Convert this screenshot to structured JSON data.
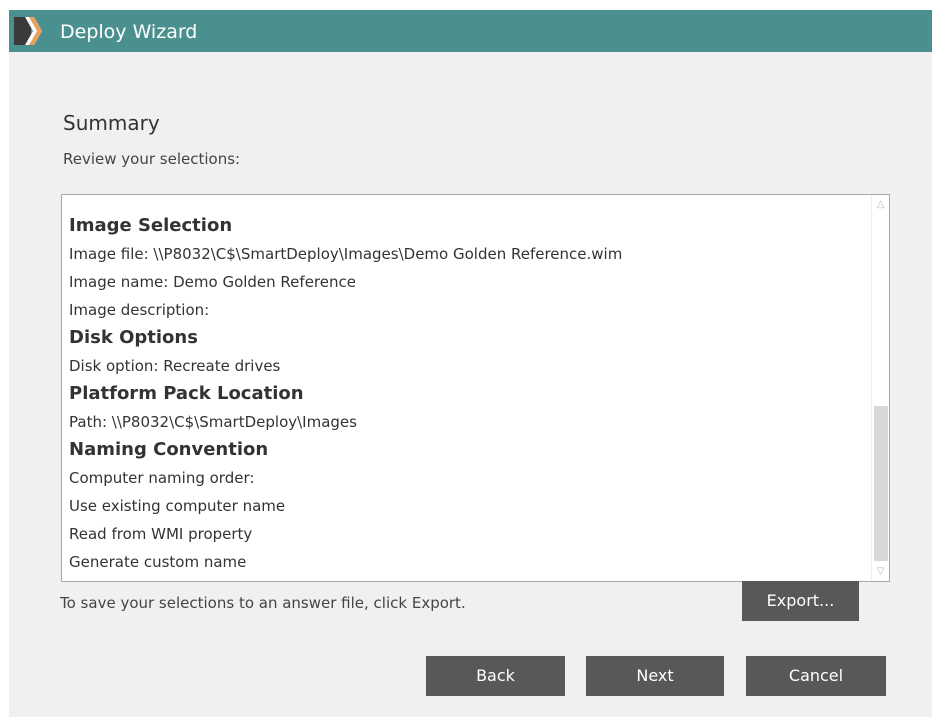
{
  "window": {
    "title": "Deploy Wizard"
  },
  "colors": {
    "titlebar": "#4a908e",
    "button": "#585858",
    "background": "#f0f0f0"
  },
  "icons": {
    "app_logo": "smartdeploy-logo-icon",
    "scroll_up": "chevron-up-icon",
    "scroll_down": "chevron-down-icon"
  },
  "page": {
    "heading": "Summary",
    "subheading": "Review your selections:"
  },
  "summary": {
    "lines": [
      {
        "type": "heading",
        "text": "Image Selection"
      },
      {
        "type": "text",
        "text": "Image file: \\\\P8032\\C$\\SmartDeploy\\Images\\Demo Golden Reference.wim"
      },
      {
        "type": "text",
        "text": "Image name: Demo Golden Reference"
      },
      {
        "type": "text",
        "text": "Image description:"
      },
      {
        "type": "heading",
        "text": "Disk Options"
      },
      {
        "type": "text",
        "text": "Disk option: Recreate drives"
      },
      {
        "type": "heading",
        "text": "Platform Pack Location"
      },
      {
        "type": "text",
        "text": "Path: \\\\P8032\\C$\\SmartDeploy\\Images"
      },
      {
        "type": "heading",
        "text": "Naming Convention"
      },
      {
        "type": "text",
        "text": "Computer naming order:"
      },
      {
        "type": "text",
        "text": "Use existing computer name"
      },
      {
        "type": "text",
        "text": "Read from WMI property"
      },
      {
        "type": "text",
        "text": "Generate custom name"
      }
    ]
  },
  "footer": {
    "hint": "To save your selections to an answer file, click Export.",
    "export_label": "Export...",
    "back_label": "Back",
    "next_label": "Next",
    "cancel_label": "Cancel"
  }
}
